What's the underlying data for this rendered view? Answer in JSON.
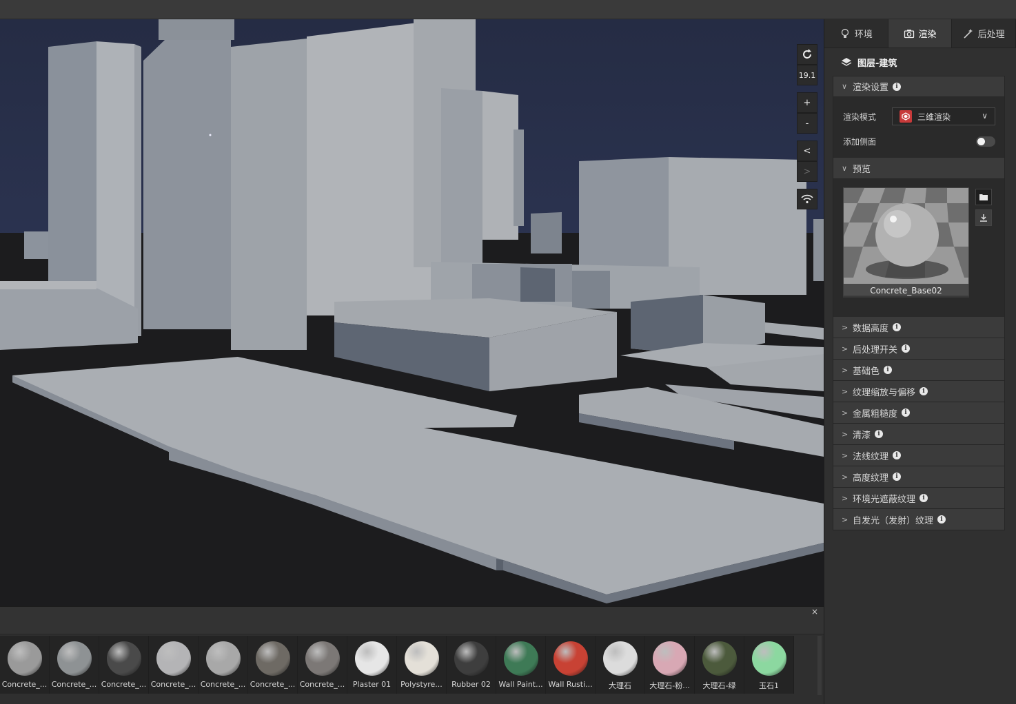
{
  "viewport_tools": {
    "refresh_icon": "refresh-icon",
    "zoom_level": "19.1",
    "zoom_in": "+",
    "zoom_out": "-",
    "collapse_left": "<",
    "collapse_right": ">",
    "signal_icon": "wifi-icon"
  },
  "tabs": [
    {
      "label": "环境",
      "icon": "bulb-icon"
    },
    {
      "label": "渲染",
      "icon": "camera-icon"
    },
    {
      "label": "后处理",
      "icon": "wand-icon"
    }
  ],
  "active_tab": "渲染",
  "layer": {
    "title": "图层-建筑",
    "icon": "layers-icon"
  },
  "render_settings": {
    "header": "渲染设置",
    "mode_label": "渲染模式",
    "mode_value": "三维渲染",
    "side_label": "添加侧面",
    "side_enabled": false
  },
  "preview": {
    "header": "预览",
    "material_name": "Concrete_Base02",
    "open_icon": "folder-icon",
    "download_icon": "download-icon"
  },
  "sections": [
    "数据高度",
    "后处理开关",
    "基础色",
    "纹理缩放与偏移",
    "金属粗糙度",
    "清漆",
    "法线纹理",
    "高度纹理",
    "环境光遮蔽纹理",
    "自发光（发射）纹理"
  ],
  "bottom_panel": {
    "close": "×",
    "materials": [
      {
        "label": "Concrete_...",
        "color": "#9a9a9a"
      },
      {
        "label": "Concrete_...",
        "color": "#8e9294"
      },
      {
        "label": "Concrete_...",
        "color": "#4a4a4a"
      },
      {
        "label": "Concrete_...",
        "color": "#b4b4b6"
      },
      {
        "label": "Concrete_...",
        "color": "#a8a8a8"
      },
      {
        "label": "Concrete_...",
        "color": "#6e6a64"
      },
      {
        "label": "Concrete_...",
        "color": "#7c7876"
      },
      {
        "label": "Plaster 01",
        "color": "#e6e6e6"
      },
      {
        "label": "Polystyre...",
        "color": "#e4e0d8"
      },
      {
        "label": "Rubber 02",
        "color": "#3e3e3e"
      },
      {
        "label": "Wall Paint...",
        "color": "#3e7a56"
      },
      {
        "label": "Wall Rusti...",
        "color": "#c84234"
      },
      {
        "label": "大理石",
        "color": "#dcdcdc"
      },
      {
        "label": "大理石-粉...",
        "color": "#d8a8b4"
      },
      {
        "label": "大理石-绿",
        "color": "#4c5a3c"
      },
      {
        "label": "玉石1",
        "color": "#8cd8a0"
      }
    ]
  }
}
